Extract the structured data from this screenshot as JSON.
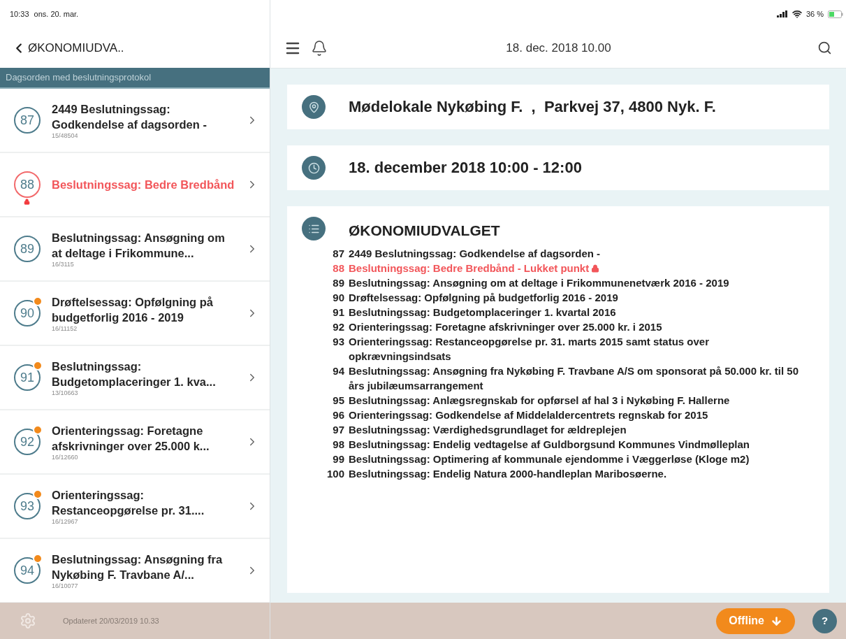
{
  "status_bar": {
    "time": "10:33",
    "date": "ons. 20. mar.",
    "battery": "36 %"
  },
  "nav": {
    "back_label": "ØKONOMIUDVA..",
    "section_header": "Dagsorden med beslutningsprotokol"
  },
  "agenda_items": [
    {
      "number": "87",
      "title": "2449 Beslutningssag: Godkendelse af dagsorden -",
      "case": "15/48504",
      "locked": false,
      "flagged": false
    },
    {
      "number": "88",
      "title": "Beslutningssag: Bedre Bredbånd",
      "locked": true,
      "flagged": false
    },
    {
      "number": "89",
      "title": "Beslutningssag: Ansøgning om at deltage i Frikommune...",
      "case": "16/3115",
      "locked": false,
      "flagged": false
    },
    {
      "number": "90",
      "title": "Drøftelsessag: Opfølgning på budgetforlig 2016 - 2019",
      "case": "16/11152",
      "locked": false,
      "flagged": true
    },
    {
      "number": "91",
      "title": "Beslutningssag: Budgetomplaceringer 1. kva...",
      "case": "13/10663",
      "locked": false,
      "flagged": true
    },
    {
      "number": "92",
      "title": "Orienteringssag: Foretagne afskrivninger over 25.000 k...",
      "case": "16/12660",
      "locked": false,
      "flagged": true
    },
    {
      "number": "93",
      "title": "Orienteringssag: Restanceopgørelse pr. 31....",
      "case": "16/12967",
      "locked": false,
      "flagged": true
    },
    {
      "number": "94",
      "title": "Beslutningssag: Ansøgning fra Nykøbing F. Travbane A/...",
      "case": "16/10077",
      "locked": false,
      "flagged": true
    }
  ],
  "sidebar_footer": {
    "updated": "Opdateret 20/03/2019 10.33"
  },
  "toolbar": {
    "title": "18. dec. 2018 10.00"
  },
  "meeting": {
    "location": "Mødelokale Nykøbing F.  ,  Parkvej 37, 4800 Nyk. F.",
    "time": "18. december 2018 10:00 - 12:00",
    "committee": "ØKONOMIUDVALGET",
    "agenda": [
      {
        "number": "87",
        "title": "2449 Beslutningssag: Godkendelse af dagsorden -",
        "locked": false
      },
      {
        "number": "88",
        "title": "Beslutningssag: Bedre Bredbånd - Lukket punkt",
        "locked": true
      },
      {
        "number": "89",
        "title": "Beslutningssag: Ansøgning om at deltage i Frikommunenetværk 2016 - 2019",
        "locked": false
      },
      {
        "number": "90",
        "title": "Drøftelsessag: Opfølgning på budgetforlig 2016 - 2019",
        "locked": false
      },
      {
        "number": "91",
        "title": "Beslutningssag: Budgetomplaceringer 1. kvartal 2016",
        "locked": false
      },
      {
        "number": "92",
        "title": "Orienteringssag: Foretagne afskrivninger over 25.000 kr. i 2015",
        "locked": false
      },
      {
        "number": "93",
        "title": "Orienteringssag: Restanceopgørelse pr. 31. marts 2015 samt status over opkrævningsindsats",
        "locked": false
      },
      {
        "number": "94",
        "title": "Beslutningssag: Ansøgning fra Nykøbing F. Travbane A/S om sponsorat på 50.000 kr. til 50 års jubilæumsarrangement",
        "locked": false
      },
      {
        "number": "95",
        "title": "Beslutningssag: Anlægsregnskab for opførsel af hal 3 i Nykøbing F. Hallerne",
        "locked": false
      },
      {
        "number": "96",
        "title": "Orienteringssag: Godkendelse af Middelaldercentrets regnskab for 2015",
        "locked": false
      },
      {
        "number": "97",
        "title": "Beslutningssag: Værdighedsgrundlaget for ældreplejen",
        "locked": false
      },
      {
        "number": "98",
        "title": "Beslutningssag: Endelig vedtagelse af Guldborgsund Kommunes Vindmølleplan",
        "locked": false
      },
      {
        "number": "99",
        "title": "Beslutningssag: Optimering af kommunale ejendomme i Væggerløse (Kloge m2)",
        "locked": false
      },
      {
        "number": "100",
        "title": "Beslutningssag: Endelig Natura 2000-handleplan Maribosøerne.",
        "locked": false
      }
    ]
  },
  "footer": {
    "offline_button": "Offline",
    "help_button": "?"
  }
}
